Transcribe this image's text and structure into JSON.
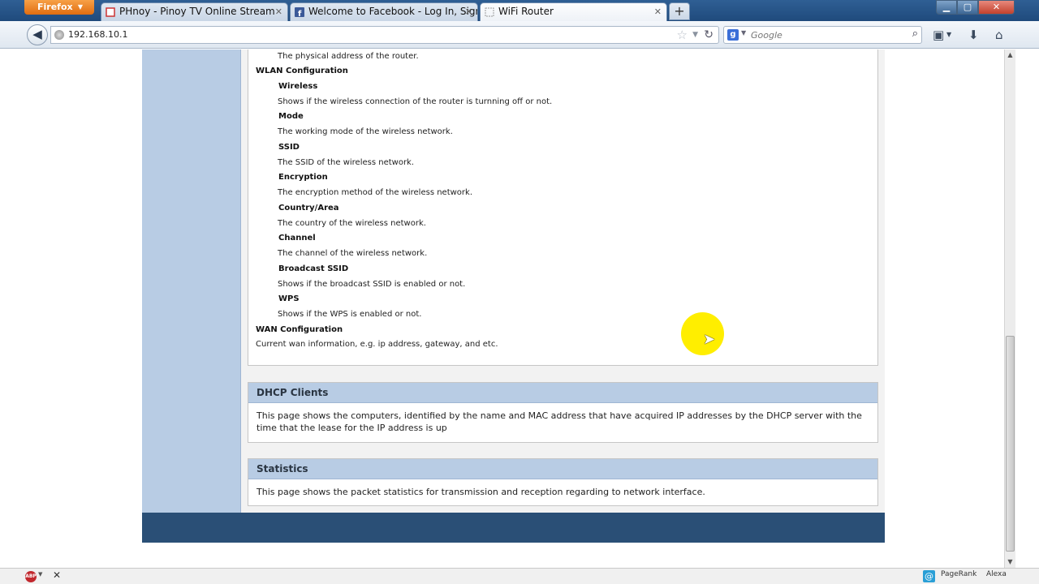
{
  "browser": {
    "app_button": "Firefox",
    "tabs": [
      {
        "title": "PHnoy - Pinoy TV Online Stream"
      },
      {
        "title": "Welcome to Facebook - Log In, Sign ..."
      },
      {
        "title": "WiFi Router"
      }
    ],
    "new_tab": "+",
    "url": "192.168.10.1",
    "search_placeholder": "Google"
  },
  "help": {
    "top_description": "The physical address of the router.",
    "wlan_title": "WLAN Configuration",
    "wlan_items": [
      {
        "label": "Wireless",
        "desc": "Shows if the wireless connection of the router is turnning off or not."
      },
      {
        "label": "Mode",
        "desc": "The working mode of the wireless network."
      },
      {
        "label": "SSID",
        "desc": "The SSID of the wireless network."
      },
      {
        "label": "Encryption",
        "desc": "The encryption method of the wireless network."
      },
      {
        "label": "Country/Area",
        "desc": "The country of the wireless network."
      },
      {
        "label": "Channel",
        "desc": "The channel of the wireless network."
      },
      {
        "label": "Broadcast SSID",
        "desc": "Shows if the broadcast SSID is enabled or not."
      },
      {
        "label": "WPS",
        "desc": "Shows if the WPS is enabled or not."
      }
    ],
    "wan_title": "WAN Configuration",
    "wan_desc": "Current wan information, e.g. ip address, gateway, and etc."
  },
  "sections": {
    "dhcp": {
      "title": "DHCP Clients",
      "body": "This page shows the computers, identified by the name and MAC address that have acquired IP addresses by the DHCP server with the time that the lease for the IP address is up"
    },
    "stats": {
      "title": "Statistics",
      "body": "This page shows the packet statistics for transmission and reception regarding to network interface."
    }
  },
  "addon_bar": {
    "pagerank": "PageRank",
    "alexa": "Alexa",
    "abp": "ABP"
  }
}
